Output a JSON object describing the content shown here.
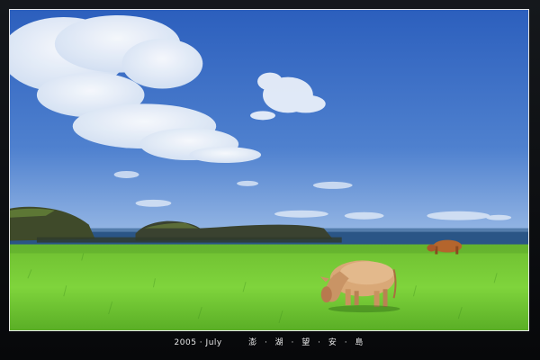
{
  "caption": {
    "date": "2005 · July",
    "place": "澎 · 湖 · 望 · 安 · 島"
  },
  "scene": {
    "colors": {
      "sky_top": "#2f63c0",
      "sky_bottom": "#8fb3e4",
      "sea": "#1f4a7a",
      "grass_light": "#7fcf3a",
      "grass_dark": "#3e8f1d",
      "cow_main": "#d9a877",
      "cow_distant": "#b8692f",
      "frame": "#0b0d10"
    },
    "icons": [
      "cow",
      "cloud",
      "island"
    ]
  }
}
